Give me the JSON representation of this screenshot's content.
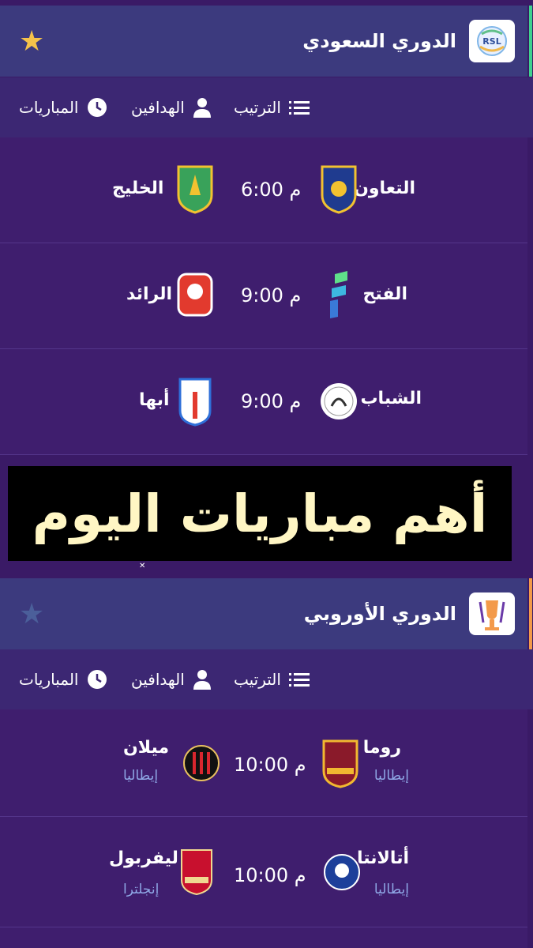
{
  "leagues": [
    {
      "name": "الدوري السعودي",
      "logo_text": "RSL",
      "star_color": "#f5c24a",
      "accent_color": "#3fd28f",
      "tabs": {
        "standings": "الترتيب",
        "scorers": "الهدافين",
        "matches": "المباريات"
      },
      "matches": [
        {
          "home": "التعاون",
          "away": "الخليج",
          "time": "6:00 م"
        },
        {
          "home": "الفتح",
          "away": "الرائد",
          "time": "9:00 م"
        },
        {
          "home": "الشباب",
          "away": "أبها",
          "time": "9:00 م"
        }
      ]
    },
    {
      "name": "الدوري الأوروبي",
      "star_color": "#4b5f9a",
      "accent_color": "#f39a4a",
      "tabs": {
        "standings": "الترتيب",
        "scorers": "الهدافين",
        "matches": "المباريات"
      },
      "matches": [
        {
          "home": "روما",
          "home_country": "إيطاليا",
          "away": "ميلان",
          "away_country": "إيطاليا",
          "time": "10:00 م"
        },
        {
          "home": "أتالانتا",
          "home_country": "إيطاليا",
          "away": "ليفربول",
          "away_country": "إنجلترا",
          "time": "10:00 م"
        }
      ]
    }
  ],
  "banner": {
    "text": "أهم مباريات اليوم"
  }
}
